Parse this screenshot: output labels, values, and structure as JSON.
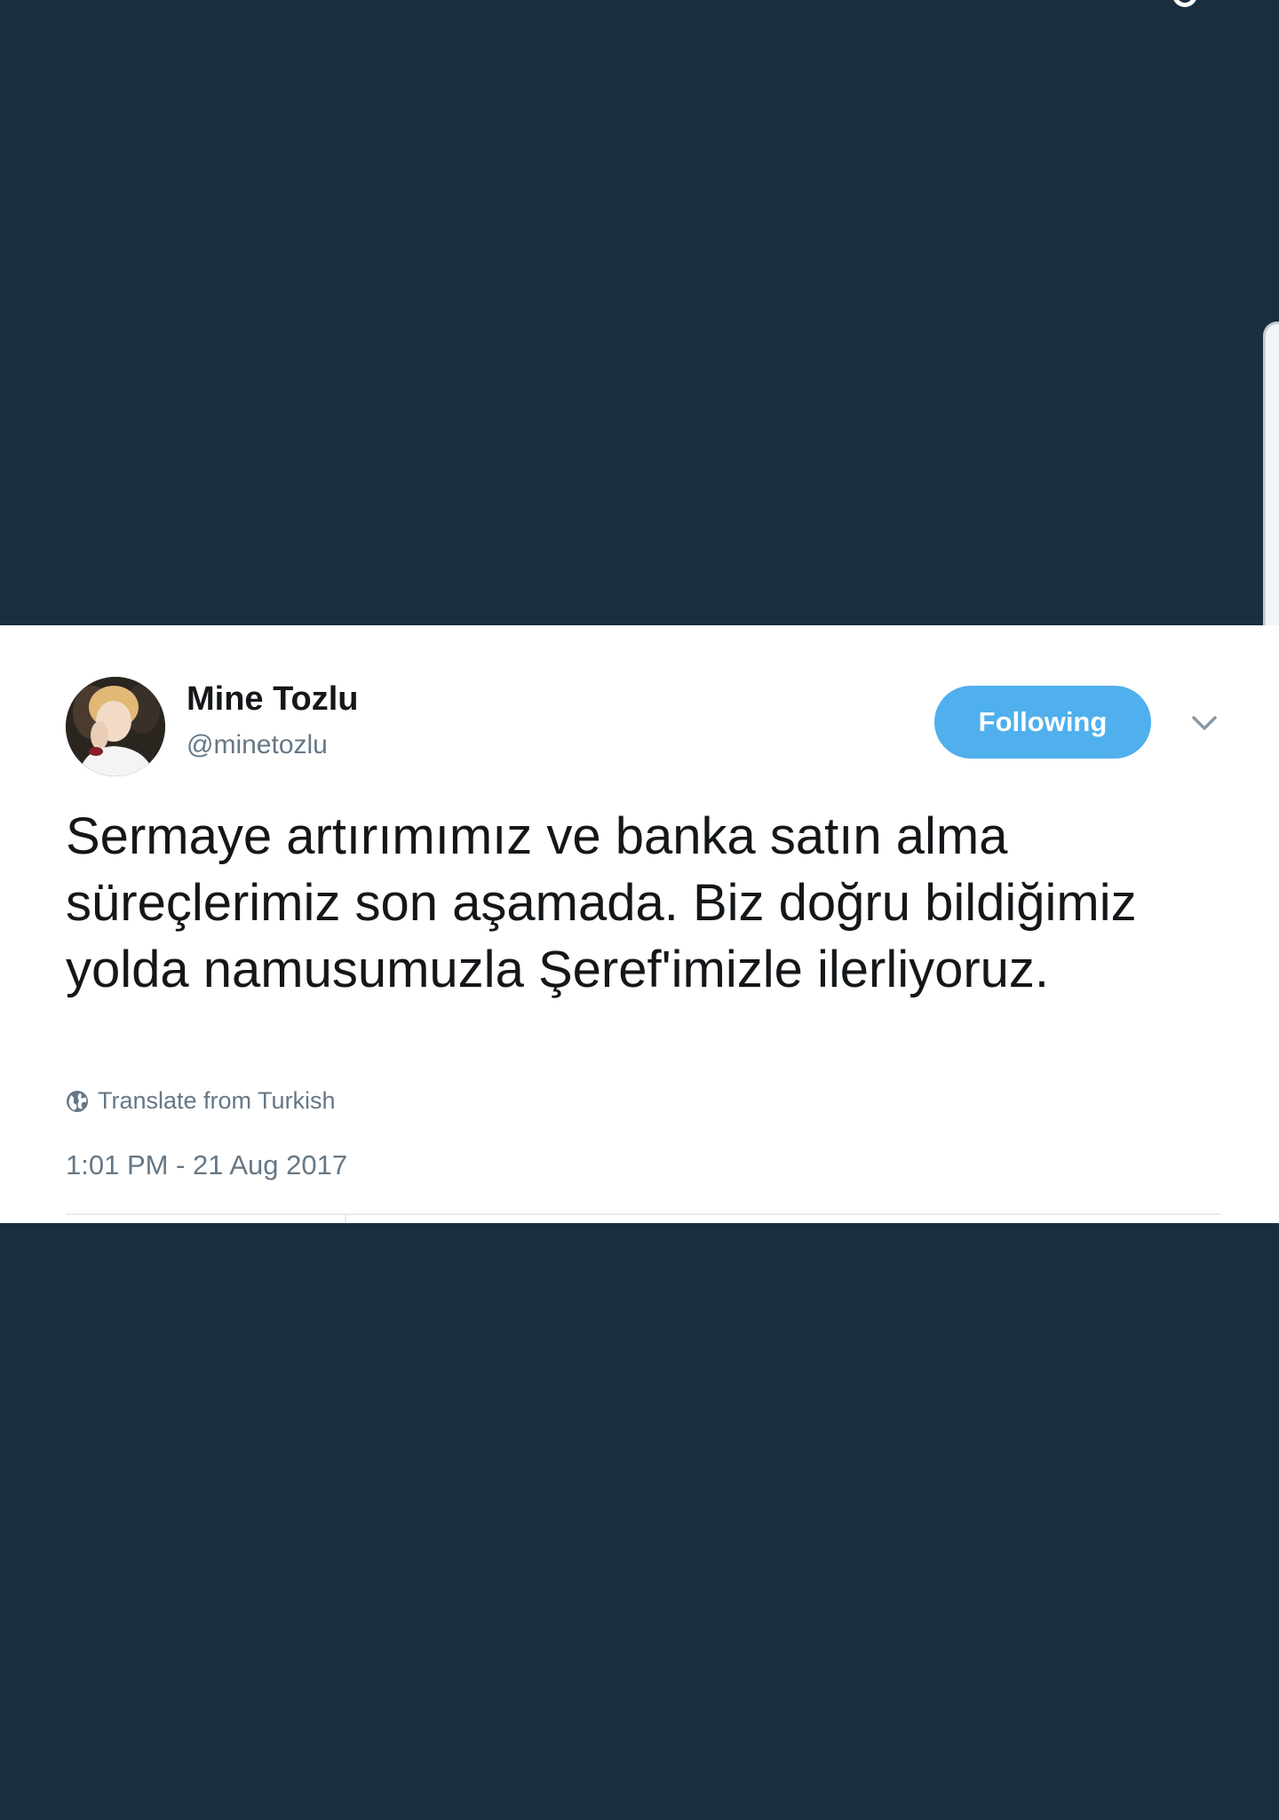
{
  "tweet": {
    "author": {
      "name": "Mine Tozlu",
      "handle": "@minetozlu"
    },
    "follow_label": "Following",
    "text": "Sermaye artırımımız ve banka satın alma süreçlerimiz son aşamada. Biz doğru bildiğimiz yolda namusumuzla Şeref'imizle ilerliyoruz.",
    "translate_label": "Translate from Turkish",
    "timestamp": "1:01 PM - 21 Aug 2017"
  },
  "icons": {
    "menu": "chevron-down-icon",
    "translate": "globe-icon"
  },
  "colors": {
    "background": "#1b2e3f",
    "card": "#ffffff",
    "accent": "#4fb0ed",
    "secondary_text": "#657786",
    "primary_text": "#14171a"
  }
}
